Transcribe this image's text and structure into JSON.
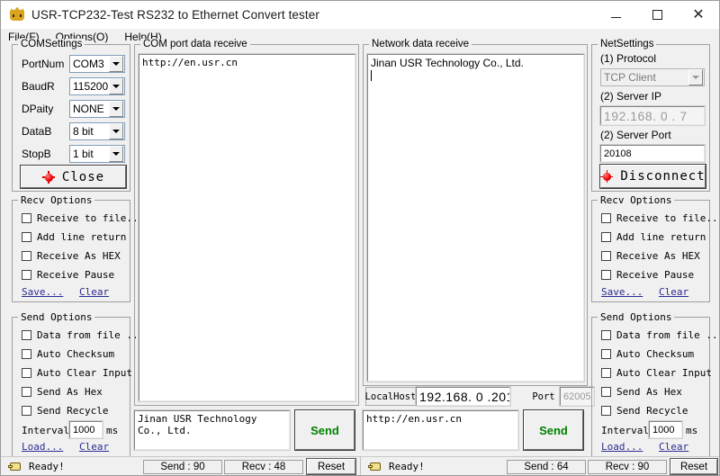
{
  "window": {
    "title": "USR-TCP232-Test  RS232 to Ethernet Convert tester",
    "app_icon": "crown-icon",
    "minimize": "—",
    "maximize": "□",
    "close": "✕"
  },
  "menubar": {
    "items": [
      {
        "label": "File(F)"
      },
      {
        "label": "Options(O)"
      },
      {
        "label": "Help(H)"
      }
    ]
  },
  "com_settings": {
    "title": "COMSettings",
    "fields": [
      {
        "label": "PortNum",
        "value": "COM3"
      },
      {
        "label": "BaudR",
        "value": "115200"
      },
      {
        "label": "DPaity",
        "value": "NONE"
      },
      {
        "label": "DataB",
        "value": "8 bit"
      },
      {
        "label": "StopB",
        "value": "1 bit"
      }
    ],
    "action_button": "Close"
  },
  "left_recv_options": {
    "title": "Recv Options",
    "checkboxes": [
      {
        "label": "Receive to file...",
        "checked": false
      },
      {
        "label": "Add line return",
        "checked": false
      },
      {
        "label": "Receive As HEX",
        "checked": false
      },
      {
        "label": "Receive Pause",
        "checked": false
      }
    ],
    "save_link": "Save...",
    "clear_link": "Clear"
  },
  "left_send_options": {
    "title": "Send Options",
    "checkboxes": [
      {
        "label": "Data from file ...",
        "checked": false
      },
      {
        "label": "Auto Checksum",
        "checked": false
      },
      {
        "label": "Auto Clear Input",
        "checked": false
      },
      {
        "label": "Send As Hex",
        "checked": false
      },
      {
        "label": "Send Recycle",
        "checked": false
      }
    ],
    "interval_label": "Interval",
    "interval_value": "1000",
    "interval_unit": "ms",
    "load_link": "Load...",
    "clear_link": "Clear"
  },
  "com_receive": {
    "title": "COM port data receive",
    "text": "http://en.usr.cn"
  },
  "com_send": {
    "text": "Jinan USR Technology Co., Ltd.",
    "send_button": "Send"
  },
  "net_receive": {
    "title": "Network data receive",
    "text": "Jinan USR Technology Co., Ltd."
  },
  "net_host_bar": {
    "localhost_label": "LocalHost",
    "localhost_value": "192.168. 0  .201",
    "port_label": "Port",
    "port_value": "62005"
  },
  "net_send": {
    "text": "http://en.usr.cn",
    "send_button": "Send"
  },
  "net_settings": {
    "title": "NetSettings",
    "protocol_label": "(1) Protocol",
    "protocol_value": "TCP Client",
    "server_ip_label": "(2) Server IP",
    "server_ip_value": "192.168. 0  . 7",
    "server_port_label": "(2) Server Port",
    "server_port_value": "20108",
    "action_button": "Disconnect"
  },
  "right_recv_options": {
    "title": "Recv Options",
    "checkboxes": [
      {
        "label": "Receive to file...",
        "checked": false
      },
      {
        "label": "Add line return",
        "checked": false
      },
      {
        "label": "Receive As HEX",
        "checked": false
      },
      {
        "label": "Receive Pause",
        "checked": false
      }
    ],
    "save_link": "Save...",
    "clear_link": "Clear"
  },
  "right_send_options": {
    "title": "Send Options",
    "checkboxes": [
      {
        "label": "Data from file ...",
        "checked": false
      },
      {
        "label": "Auto Checksum",
        "checked": false
      },
      {
        "label": "Auto Clear Input",
        "checked": false
      },
      {
        "label": "Send As Hex",
        "checked": false
      },
      {
        "label": "Send Recycle",
        "checked": false
      }
    ],
    "interval_label": "Interval",
    "interval_value": "1000",
    "interval_unit": "ms",
    "load_link": "Load...",
    "clear_link": "Clear"
  },
  "status_left": {
    "icon": "pointing-hand-icon",
    "ready_text": "Ready!",
    "send_counter": "Send : 90",
    "recv_counter": "Recv : 48",
    "reset_button": "Reset"
  },
  "status_right": {
    "icon": "pointing-hand-icon",
    "ready_text": "Ready!",
    "send_counter": "Send : 64",
    "recv_counter": "Recv : 90",
    "reset_button": "Reset"
  },
  "colors": {
    "send_text": "#008000",
    "link": "#2b2b8f",
    "led": "#e00000",
    "window_bg": "#f0f0f0"
  }
}
